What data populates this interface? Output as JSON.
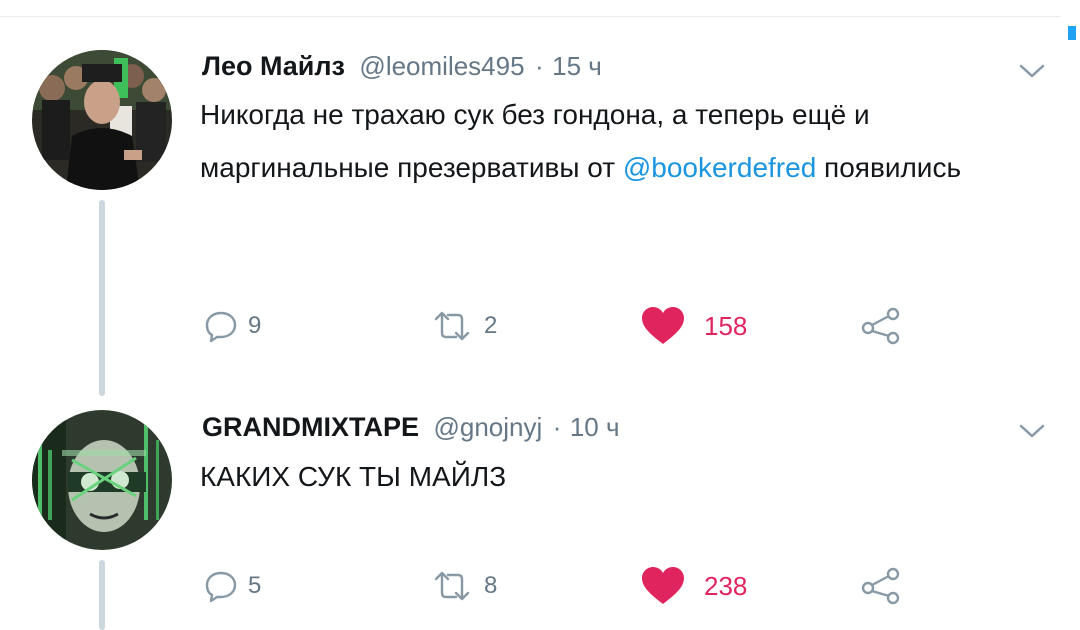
{
  "colors": {
    "like": "#e0245e",
    "mention": "#1b95e0",
    "muted": "#657786",
    "thread_line": "#ccd6dd",
    "accent": "#1da1f2"
  },
  "tweets": [
    {
      "name": "Лео Майлз",
      "handle": "@leomiles495",
      "separator": "·",
      "time": "15 ч",
      "text_before": "Никогда не трахаю сук без гондона, а теперь ещё и маргинальные презервативы от ",
      "mention": "@bookerdefred",
      "text_after": " появились",
      "replies": "9",
      "retweets": "2",
      "likes": "158",
      "liked": true,
      "avatar": "photo-group-of-people",
      "menu_icon": "chevron-down-icon"
    },
    {
      "name": "GRANDMIXTAPE",
      "handle": "@gnojnyj",
      "separator": "·",
      "time": "10 ч",
      "text": "КАКИХ СУК ТЫ МАЙЛЗ",
      "replies": "5",
      "retweets": "8",
      "likes": "238",
      "liked": true,
      "avatar": "green-glitch-face",
      "menu_icon": "chevron-down-icon"
    }
  ]
}
